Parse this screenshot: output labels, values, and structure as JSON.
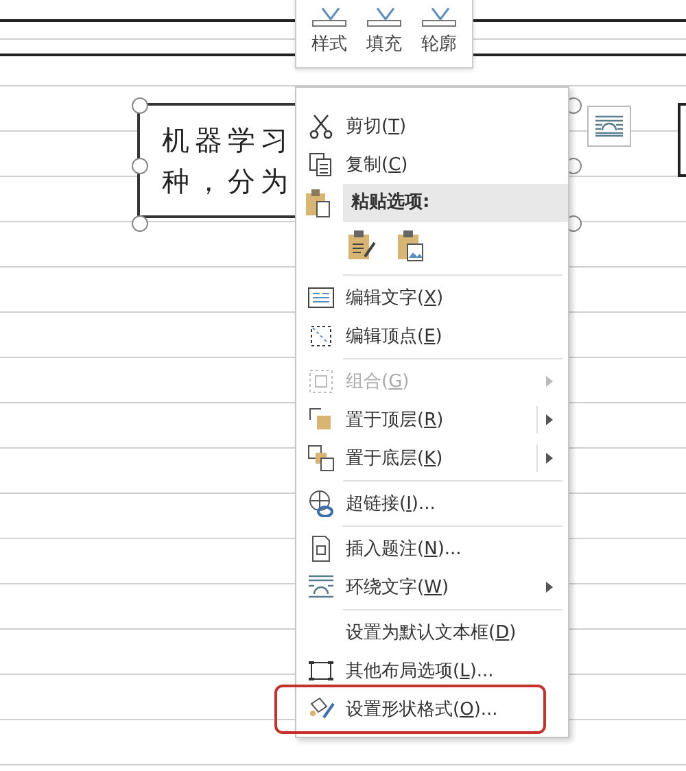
{
  "mini_toolbar": {
    "buttons": [
      {
        "label": "样式"
      },
      {
        "label": "填充"
      },
      {
        "label": "轮廓"
      }
    ]
  },
  "text_box": {
    "lines": [
      "机器学习",
      "种，分为"
    ]
  },
  "context_menu": {
    "items": [
      {
        "kind": "item",
        "before": "剪切(",
        "key": "T",
        "after": ")",
        "disabled": false,
        "submenu": false,
        "split": false,
        "separator_before": false,
        "annotated": false
      },
      {
        "kind": "item",
        "before": "复制(",
        "key": "C",
        "after": ")",
        "disabled": false,
        "submenu": false,
        "split": false,
        "separator_before": false,
        "annotated": false
      },
      {
        "kind": "header",
        "label": "粘贴选项:"
      },
      {
        "kind": "paste-row"
      },
      {
        "kind": "item",
        "before": "编辑文字(",
        "key": "X",
        "after": ")",
        "disabled": false,
        "submenu": false,
        "split": false,
        "separator_before": true,
        "annotated": false
      },
      {
        "kind": "item",
        "before": "编辑顶点(",
        "key": "E",
        "after": ")",
        "disabled": false,
        "submenu": false,
        "split": false,
        "separator_before": false,
        "annotated": false
      },
      {
        "kind": "item",
        "before": "组合(",
        "key": "G",
        "after": ")",
        "disabled": true,
        "submenu": true,
        "split": false,
        "separator_before": true,
        "annotated": false
      },
      {
        "kind": "item",
        "before": "置于顶层(",
        "key": "R",
        "after": ")",
        "disabled": false,
        "submenu": true,
        "split": true,
        "separator_before": false,
        "annotated": false
      },
      {
        "kind": "item",
        "before": "置于底层(",
        "key": "K",
        "after": ")",
        "disabled": false,
        "submenu": true,
        "split": true,
        "separator_before": false,
        "annotated": false
      },
      {
        "kind": "item",
        "before": "超链接(",
        "key": "I",
        "after": ")...",
        "disabled": false,
        "submenu": false,
        "split": false,
        "separator_before": true,
        "annotated": false
      },
      {
        "kind": "item",
        "before": "插入题注(",
        "key": "N",
        "after": ")...",
        "disabled": false,
        "submenu": false,
        "split": false,
        "separator_before": true,
        "annotated": false
      },
      {
        "kind": "item",
        "before": "环绕文字(",
        "key": "W",
        "after": ")",
        "disabled": false,
        "submenu": true,
        "split": false,
        "separator_before": false,
        "annotated": false
      },
      {
        "kind": "item",
        "before": "设置为默认文本框(",
        "key": "D",
        "after": ")",
        "disabled": false,
        "submenu": false,
        "split": false,
        "separator_before": true,
        "annotated": false
      },
      {
        "kind": "item",
        "before": "其他布局选项(",
        "key": "L",
        "after": ")...",
        "disabled": false,
        "submenu": false,
        "split": false,
        "separator_before": false,
        "annotated": false
      },
      {
        "kind": "item",
        "before": "设置形状格式(",
        "key": "O",
        "after": ")...",
        "disabled": false,
        "submenu": false,
        "split": false,
        "separator_before": false,
        "annotated": true
      }
    ]
  }
}
